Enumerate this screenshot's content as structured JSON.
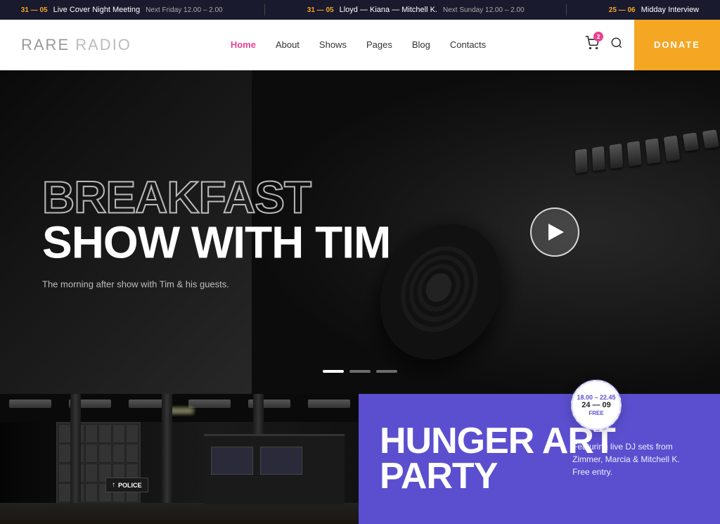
{
  "ticker": {
    "items": [
      {
        "date": "31 — 05",
        "title": "Live Cover Night Meeting",
        "time": "Next Friday 12.00 – 2.00"
      },
      {
        "date": "31 — 05",
        "title": "Lloyd — Kiana — Mitchell K.",
        "time": "Next Sunday 12.00 – 2.00"
      },
      {
        "date": "25 — 06",
        "title": "Midday Interview",
        "time": ""
      }
    ]
  },
  "header": {
    "logo_bold": "RARE",
    "logo_light": "RADIO",
    "nav": [
      {
        "label": "Home",
        "active": true
      },
      {
        "label": "About",
        "active": false
      },
      {
        "label": "Shows",
        "active": false
      },
      {
        "label": "Pages",
        "active": false
      },
      {
        "label": "Blog",
        "active": false
      },
      {
        "label": "Contacts",
        "active": false
      }
    ],
    "cart_count": "2",
    "donate_label": "DONATE"
  },
  "hero": {
    "title_outline": "BREAKFAST",
    "title_solid": "SHOW WITH TIM",
    "subtitle": "The morning after show with Tim & his guests.",
    "dots": [
      "active",
      "inactive",
      "inactive"
    ]
  },
  "event": {
    "title_line1": "HUNGER ART",
    "title_line2": "PARTY",
    "description": "Featuring live DJ sets from Zimmer, Marcia & Mitchell K. Free entry.",
    "badge_time": "18.00 – 22.45",
    "badge_date": "24 — 09",
    "badge_free": "FREE"
  }
}
